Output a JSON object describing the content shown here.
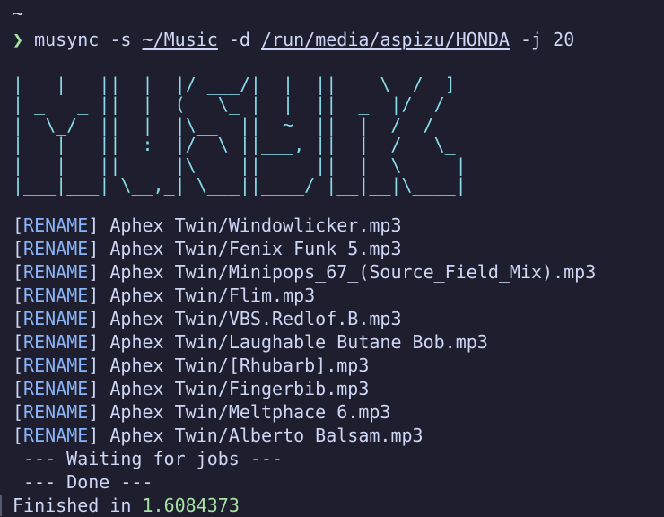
{
  "terminal": {
    "cwd": "~",
    "prompt_symbol": "❯",
    "command": {
      "program": "musync",
      "flag_source": "-s",
      "source_path": "~/Music",
      "flag_dest": "-d",
      "dest_path": "/run/media/aspizu/HONDA",
      "flag_jobs": "-j",
      "jobs": "20"
    },
    "banner_ascii": " ___ ___  __ __  _____ __ __  ____    __ \n|   |   ||  |  |/ ___/|  |  ||    \\  /  ]\n| _   _ ||  |  (   \\_ |  |  ||  _  |/  / \n|  \\_/  ||  |  |\\__  ||  ~  ||  |  /  /  \n|   |   ||  :  |/  \\ ||___, ||  |  /   \\_ \n|   |   ||     |\\    ||     ||  |  \\     |\n|___|___| \\__,_| \\___||____/ |__|__|\\____|",
    "log_tag": "RENAME",
    "log_entries": [
      "Aphex Twin/Windowlicker.mp3",
      "Aphex Twin/Fenix Funk 5.mp3",
      "Aphex Twin/Minipops_67_(Source_Field_Mix).mp3",
      "Aphex Twin/Flim.mp3",
      "Aphex Twin/VBS.Redlof.B.mp3",
      "Aphex Twin/Laughable Butane Bob.mp3",
      "Aphex Twin/[Rhubarb].mp3",
      "Aphex Twin/Fingerbib.mp3",
      "Aphex Twin/Meltphace 6.mp3",
      "Aphex Twin/Alberto Balsam.mp3"
    ],
    "status_waiting": "--- Waiting for jobs ---",
    "status_done": "--- Done ---",
    "finished_label": "Finished in ",
    "finished_value": "1.6084373"
  },
  "colors": {
    "background": "#1e1e2e",
    "foreground": "#cdd6f4",
    "prompt_green": "#a6e3a1",
    "banner_cyan": "#89dceb",
    "tag_blue": "#89b4fa"
  }
}
